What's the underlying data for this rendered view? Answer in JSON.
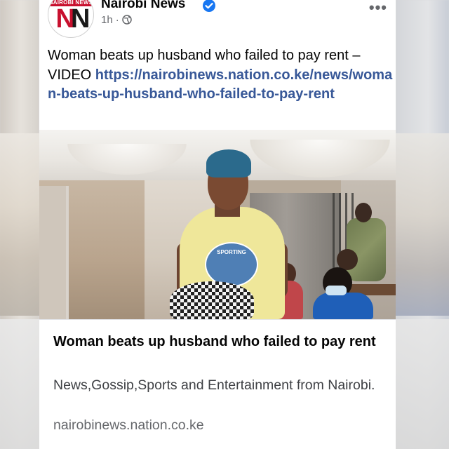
{
  "header": {
    "page_name": "Nairobi News",
    "avatar_logo_text": "NAIROBI NEWS",
    "avatar_logo_letters": "NN",
    "time": "1h",
    "separator": "·"
  },
  "post": {
    "text": "Woman beats up husband who failed to pay rent – VIDEO ",
    "link_text": "https://nairobinews.nation.co.ke/news/woman-beats-up-husband-who-failed-to-pay-rent"
  },
  "link_preview": {
    "title": "Woman beats up husband who failed to pay rent",
    "description": "News,Gossip,Sports and Entertainment from Nairobi.",
    "domain": "nairobinews.nation.co.ke"
  },
  "photo": {
    "shirt_text": "SPORTING"
  },
  "icons": {
    "verified": "verified-badge-icon",
    "audience": "globe-icon",
    "more": "more-options-icon"
  },
  "colors": {
    "accent": "#1877f2",
    "link": "#385898",
    "brand_red": "#c8102e"
  }
}
